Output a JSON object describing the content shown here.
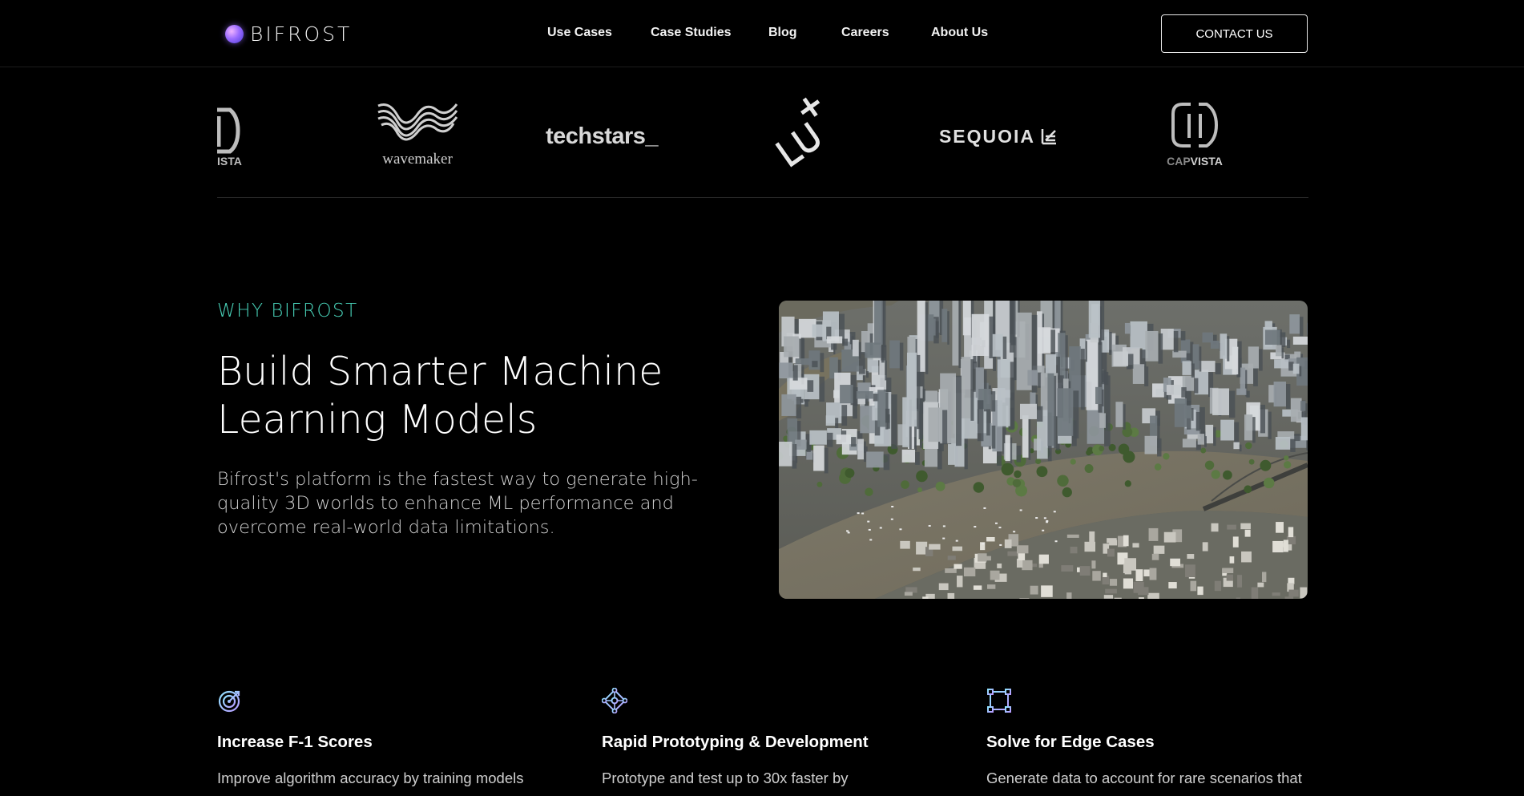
{
  "nav": {
    "brand": "BIFROST",
    "links": [
      "Use Cases",
      "Case Studies",
      "Blog",
      "Careers",
      "About Us"
    ],
    "contact_label": "CONTACT US"
  },
  "partners": [
    {
      "name": "capvista-partial",
      "text": "ISTA"
    },
    {
      "name": "wavemaker",
      "text": "wavemaker"
    },
    {
      "name": "techstars",
      "text": "techstars_"
    },
    {
      "name": "lux",
      "text": ""
    },
    {
      "name": "sequoia",
      "text": "SEQUOIA"
    },
    {
      "name": "capvista",
      "text_a": "CAP",
      "text_b": "VISTA"
    }
  ],
  "why": {
    "eyebrow": "WHY BIFROST",
    "headline_line1": "Build Smarter Machine",
    "headline_line2": "Learning Models",
    "description": "Bifrost's platform is the fastest way to generate high-quality 3D worlds to enhance ML performance and overcome real-world data limitations."
  },
  "features": [
    {
      "icon": "target-icon",
      "title": "Increase F-1 Scores",
      "text": "Improve algorithm accuracy by training models"
    },
    {
      "icon": "nodes-icon",
      "title": "Rapid Prototyping & Development",
      "text": "Prototype and test up to 30x faster by"
    },
    {
      "icon": "bounding-box-icon",
      "title": "Solve for Edge Cases",
      "text": "Generate data to account for rare scenarios that"
    }
  ],
  "colors": {
    "accent": "#48d1b8",
    "background": "#000000",
    "icon_gradient_start": "#8fe3ff",
    "icon_gradient_end": "#b79bff"
  }
}
